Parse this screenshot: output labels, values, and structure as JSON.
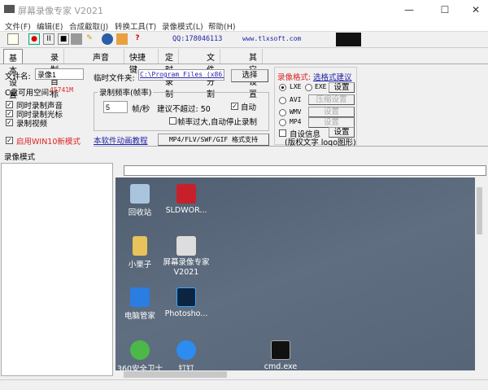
{
  "window": {
    "title": "屏幕录像专家 V2021",
    "min": "—",
    "max": "☐",
    "close": "✕"
  },
  "menu": [
    "文件(F)",
    "编辑(E)",
    "合成截取(J)",
    "转换工具(T)",
    "录像模式(L)",
    "帮助(H)"
  ],
  "toolbar": {
    "qq": "QQ:178046113",
    "site": "www.tlxsoft.com",
    "icons": [
      "new-file-icon",
      "record-icon",
      "pause-icon",
      "stop-icon",
      "camera-icon",
      "pen-icon",
      "globe-icon",
      "gift-icon",
      "help-icon"
    ]
  },
  "tabs": [
    "基本设置",
    "录制目标",
    "声音",
    "快捷键",
    "定时录制",
    "文件分割",
    "其它设置"
  ],
  "basic": {
    "filename_label": "文件名:",
    "filename": "录像1",
    "disk_label": "C盘可用空间:",
    "disk_value": "45741M",
    "checks": [
      {
        "label": "同时录制声音",
        "checked": true
      },
      {
        "label": "同时录制光标",
        "checked": true
      },
      {
        "label": "录制视频",
        "checked": true
      }
    ],
    "win10": {
      "label": "启用WIN10新模式",
      "checked": true
    },
    "temp_label": "临时文件夹:",
    "temp_path": "C:\\Program Files (x86)\\",
    "choose": "选择",
    "fps_group": "录制频率(帧率)",
    "fps": "5",
    "fps_unit": "帧/秒",
    "suggest": "建议不超过: 50",
    "auto": "自动",
    "auto_checked": true,
    "stop_label": "帧率过大,自动停止录制",
    "stop_checked": false,
    "tutorial": "本软件动画教程",
    "formats_btn": "MP4/FLV/SWF/GIF  格式支持",
    "fmt_label": "录像格式:",
    "fmt_link": "选格式建议",
    "fmt_options": [
      "LXE",
      "EXE",
      "AVI",
      "WMV",
      "MP4"
    ],
    "fmt_selected": "LXE",
    "set": "设置",
    "compress": "压缩设置",
    "custom_label": "自设信息",
    "custom_checked": false,
    "custom_note": "(版权文字 logo图形)"
  },
  "mode_tab": "录像模式",
  "desktop": [
    {
      "name": "回收站",
      "icon": "recycle-bin-icon",
      "color": "#a9c4dc"
    },
    {
      "name": "SLDWOR...",
      "icon": "solidworks-icon",
      "color": "#c8202a"
    },
    {
      "name": "小栗子",
      "icon": "folder-icon",
      "color": "#e8c25a"
    },
    {
      "name": "屏幕录像专家\nV2021",
      "icon": "recorder-icon",
      "color": "#ddd"
    },
    {
      "name": "电脑管家",
      "icon": "pc-manager-icon",
      "color": "#2a7de1"
    },
    {
      "name": "Photosho...",
      "icon": "photoshop-icon",
      "color": "#0b2540"
    },
    {
      "name": "360安全卫士",
      "icon": "360-icon",
      "color": "#4cb848"
    },
    {
      "name": "钉钉",
      "icon": "dingtalk-icon",
      "color": "#2d8cf0"
    },
    {
      "name": "cmd.exe",
      "icon": "cmd-icon",
      "color": "#111"
    }
  ]
}
